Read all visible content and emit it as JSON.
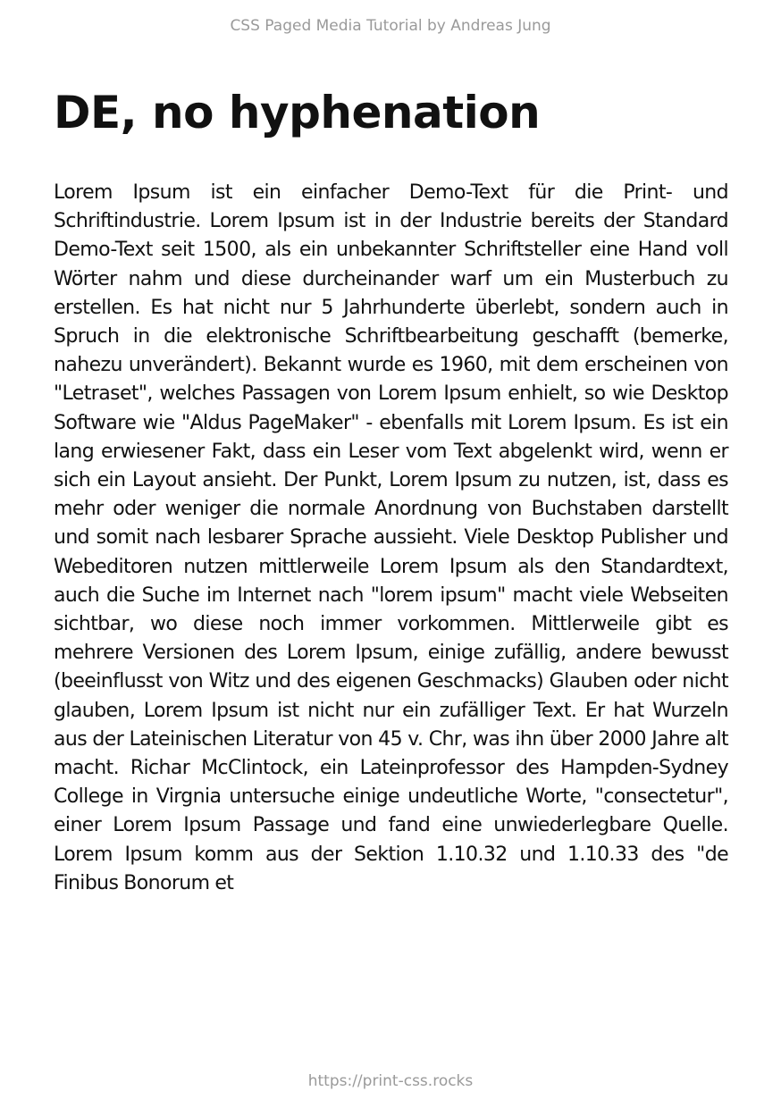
{
  "header": {
    "text": "CSS Paged Media Tutorial by Andreas Jung"
  },
  "main": {
    "title": "DE, no hyphenation",
    "body": "Lorem Ipsum ist ein einfacher Demo-Text für die Print- und Schriftindustrie. Lorem Ipsum ist in der Industrie bereits der Standard Demo-Text seit 1500, als ein unbekannter Schriftsteller eine Hand voll Wörter nahm und diese durcheinander warf um ein Musterbuch zu erstellen. Es hat nicht nur 5 Jahrhunderte überlebt, sondern auch in Spruch in die elektronische Schriftbearbeitung geschafft (bemerke, nahezu unverändert). Bekannt wurde es 1960, mit dem erscheinen von \"Letraset\", welches Passagen von Lorem Ipsum enhielt, so wie Desktop Software wie \"Aldus PageMaker\" - ebenfalls mit Lorem Ipsum. Es ist ein lang erwiesener Fakt, dass ein Leser vom Text abgelenkt wird, wenn er sich ein Layout ansieht. Der Punkt, Lorem Ipsum zu nutzen, ist, dass es mehr oder weniger die normale Anordnung von Buchstaben darstellt und somit nach lesbarer Sprache aussieht. Viele Desktop Publisher und Webeditoren nutzen mittlerweile Lorem Ipsum als den Standardtext, auch die Suche im Internet nach \"lorem ipsum\" macht viele Webseiten sichtbar, wo diese noch immer vorkommen. Mittlerweile gibt es mehrere Versionen des Lorem Ipsum, einige zufällig, andere bewusst (beeinflusst von Witz und des eigenen Geschmacks) Glauben oder nicht glauben, Lorem Ipsum ist nicht nur ein zufälliger Text. Er hat Wurzeln aus der Lateinischen Literatur von 45 v. Chr, was ihn über 2000 Jahre alt macht. Richar McClintock, ein Lateinprofessor des Hampden-Sydney College in Virgnia untersuche einige undeutliche Worte, \"consectetur\", einer Lorem Ipsum Passage und fand eine unwiederlegbare Quelle. Lorem Ipsum komm aus der Sektion 1.10.32 und 1.10.33 des \"de Finibus Bonorum et"
  },
  "footer": {
    "url": "https://print-css.rocks"
  },
  "colors": {
    "text": "#111111",
    "muted": "#9a9a9a",
    "background": "#ffffff"
  }
}
